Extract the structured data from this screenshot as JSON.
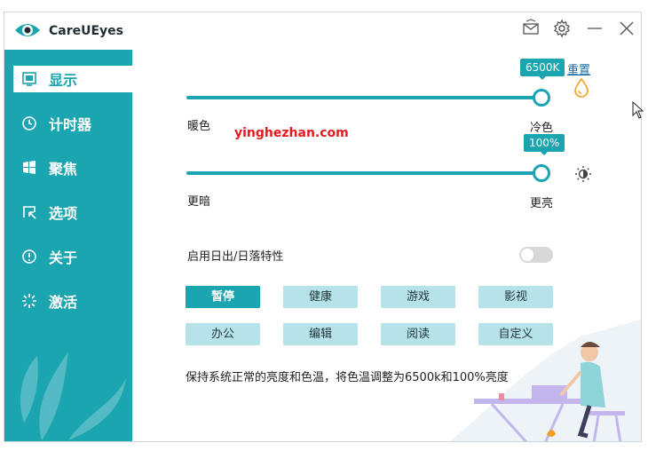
{
  "app": {
    "title": "CareUEyes"
  },
  "titlebar": {
    "icons": [
      "mail-icon",
      "gear-icon",
      "minimize-icon",
      "close-icon"
    ]
  },
  "sidebar": {
    "items": [
      {
        "label": "显示",
        "icon": "display-icon",
        "active": true
      },
      {
        "label": "计时器",
        "icon": "clock-icon",
        "active": false
      },
      {
        "label": "聚焦",
        "icon": "windows-icon",
        "active": false
      },
      {
        "label": "选项",
        "icon": "options-icon",
        "active": false
      },
      {
        "label": "关于",
        "icon": "info-icon",
        "active": false
      },
      {
        "label": "激活",
        "icon": "activate-icon",
        "active": false
      }
    ]
  },
  "color_temp": {
    "value_label": "6500K",
    "reset_label": "重置",
    "left_label": "暖色",
    "right_label": "冷色",
    "fraction": 1.0
  },
  "brightness": {
    "value_label": "100%",
    "left_label": "更暗",
    "right_label": "更亮",
    "fraction": 1.0
  },
  "sunrise": {
    "label": "启用日出/日落特性",
    "enabled": false
  },
  "modes": {
    "row1": [
      "暂停",
      "健康",
      "游戏",
      "影视"
    ],
    "row2": [
      "办公",
      "编辑",
      "阅读",
      "自定义"
    ],
    "active": "暂停"
  },
  "description": "保持系统正常的亮度和色温，将色温调整为6500k和100%亮度",
  "watermark_text": "yinghezhan.com",
  "colors": {
    "accent": "#1ba5b0",
    "button": "#b6e3ea"
  }
}
